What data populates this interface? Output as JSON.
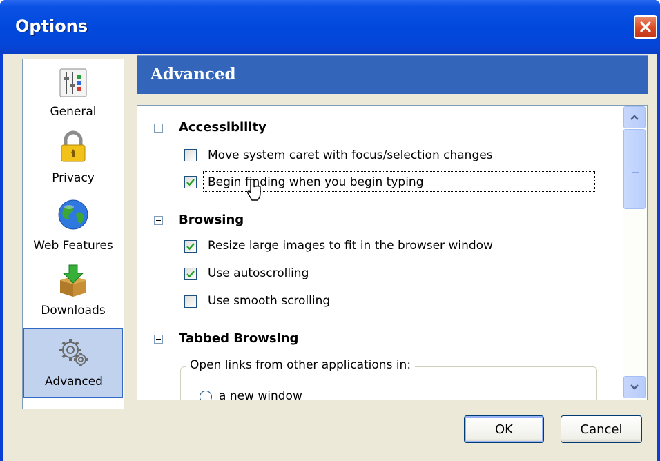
{
  "window": {
    "title": "Options"
  },
  "sidebar": {
    "items": [
      {
        "label": "General",
        "icon": "general-settings-icon"
      },
      {
        "label": "Privacy",
        "icon": "padlock-icon"
      },
      {
        "label": "Web Features",
        "icon": "globe-icon"
      },
      {
        "label": "Downloads",
        "icon": "download-box-icon"
      },
      {
        "label": "Advanced",
        "icon": "gears-icon",
        "selected": true
      }
    ]
  },
  "panel": {
    "title": "Advanced",
    "sections": [
      {
        "title": "Accessibility",
        "options": [
          {
            "label": "Move system caret with focus/selection changes",
            "checked": false
          },
          {
            "label": "Begin finding when you begin typing",
            "checked": true
          }
        ]
      },
      {
        "title": "Browsing",
        "options": [
          {
            "label": "Resize large images to fit in the browser window",
            "checked": true
          },
          {
            "label": "Use autoscrolling",
            "checked": true
          },
          {
            "label": "Use smooth scrolling",
            "checked": false
          }
        ]
      },
      {
        "title": "Tabbed Browsing",
        "group_label": "Open links from other applications in:",
        "radio_options": [
          {
            "label": "a new window",
            "selected": false
          }
        ]
      }
    ]
  },
  "buttons": {
    "ok": "OK",
    "cancel": "Cancel"
  },
  "colors": {
    "title_bar": "#0049dc",
    "header_bar": "#3366bb",
    "close_button": "#d94a22",
    "dialog_bg": "#ece9d8",
    "selection": "#c1d2ee"
  }
}
